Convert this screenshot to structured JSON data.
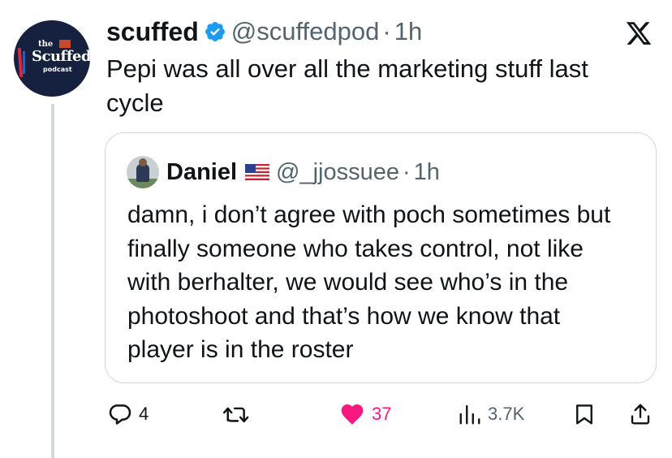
{
  "author": {
    "name": "scuffed",
    "handle": "@scuffedpod",
    "time": "1h",
    "verified": true,
    "avatar_logo": {
      "line1": "the",
      "line2": "Scuffed",
      "line3": "podcast"
    }
  },
  "tweet": {
    "text": "Pepi was all over all the marketing stuff last cycle"
  },
  "quoted": {
    "name": "Daniel",
    "handle": "@_jjossuee",
    "time": "1h",
    "text": "damn, i don’t agree with poch sometimes but finally someone who takes control, not like with berhalter, we would see who’s in the photoshoot and that’s how we know that player is in the roster"
  },
  "actions": {
    "replies": "4",
    "likes": "37",
    "views": "3.7K"
  },
  "colors": {
    "text": "#0f1419",
    "secondary": "#536471",
    "like": "#f91880",
    "verified": "#1d9bf0",
    "border": "#cfd9de"
  },
  "icons": [
    "x-logo-icon",
    "verified-badge-icon",
    "us-flag-icon",
    "reply-icon",
    "repost-icon",
    "like-icon",
    "views-icon",
    "bookmark-icon",
    "share-icon"
  ]
}
